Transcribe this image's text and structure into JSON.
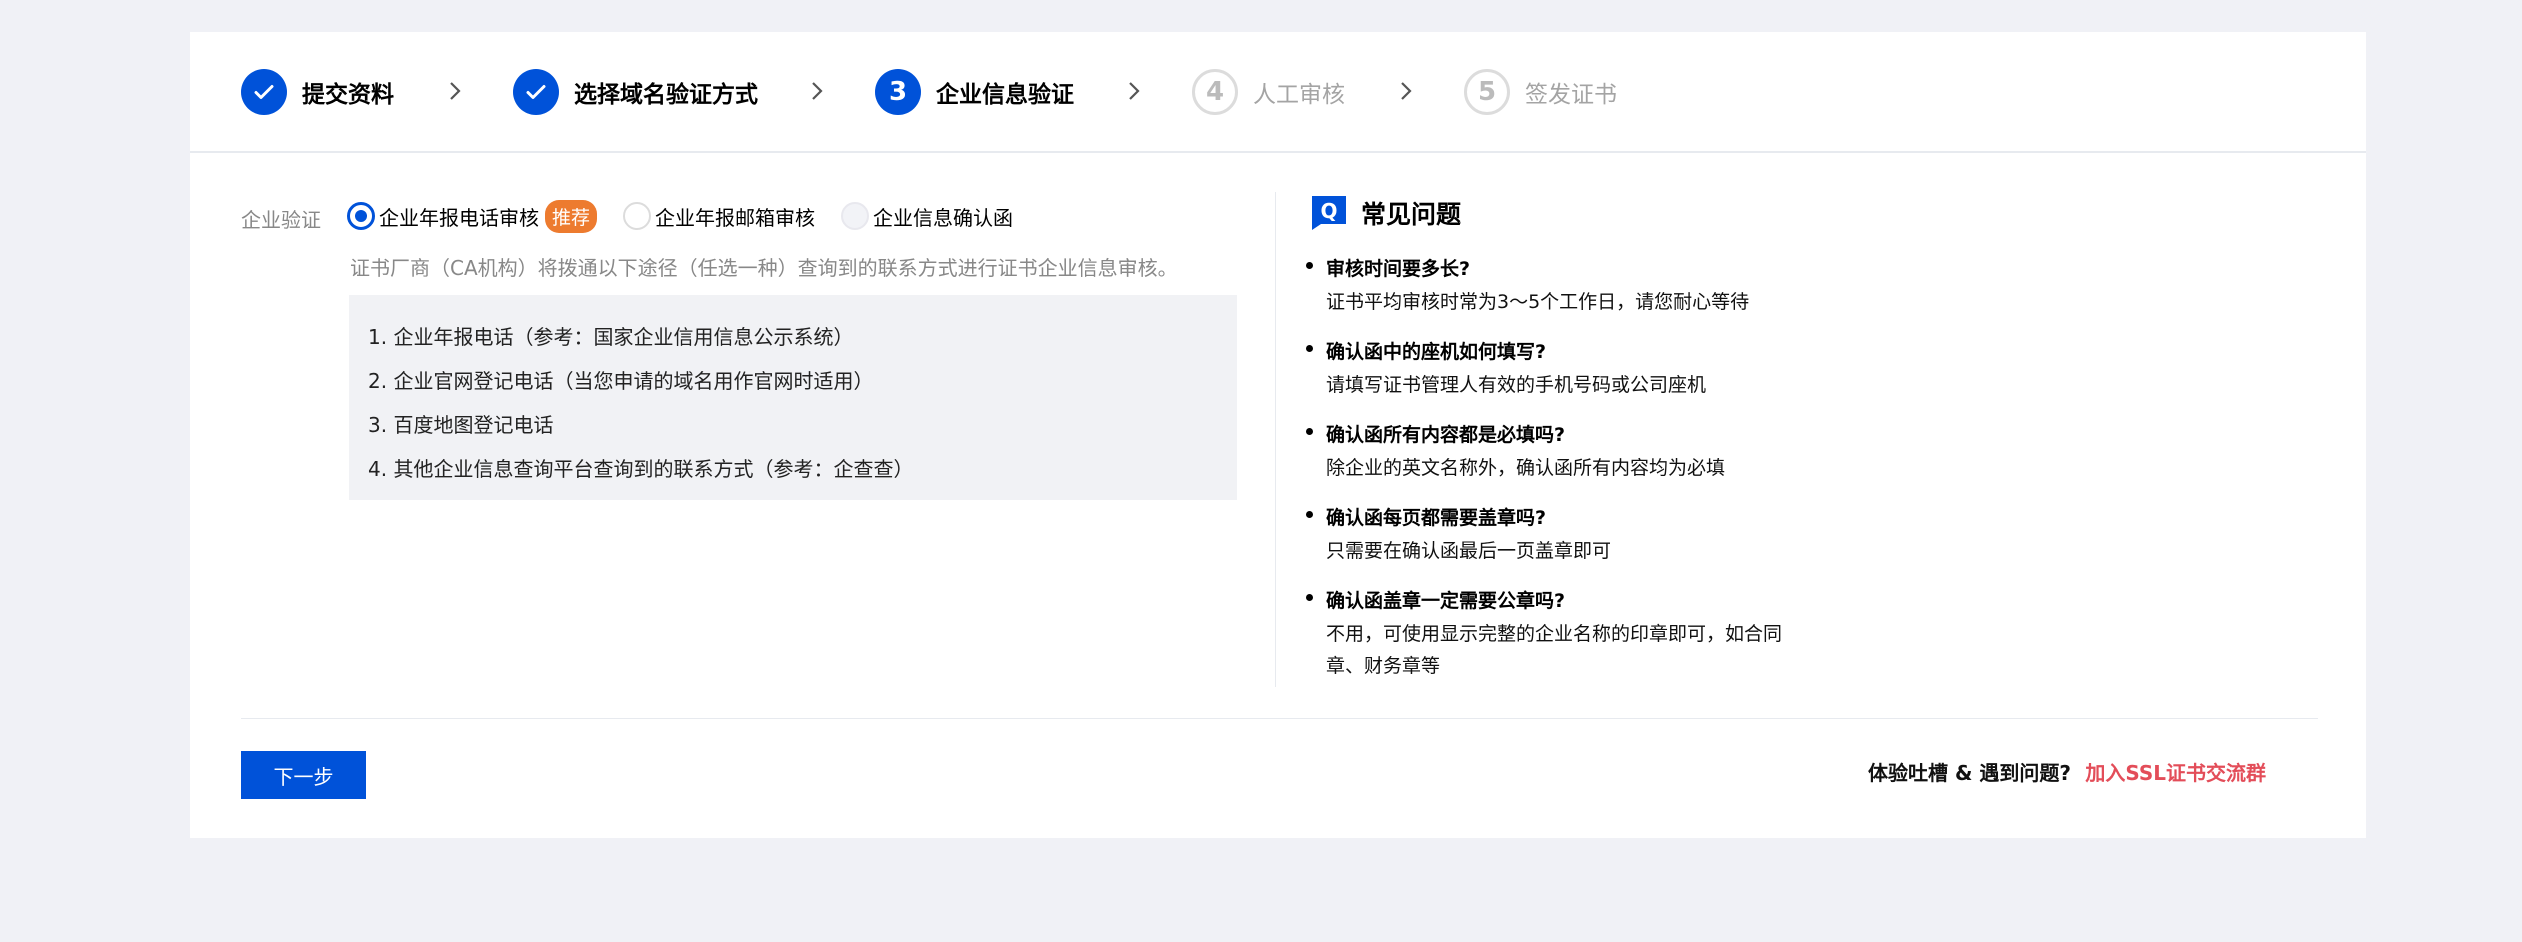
{
  "steps": [
    {
      "number": "✓",
      "label": "提交资料",
      "state": "done"
    },
    {
      "number": "✓",
      "label": "选择域名验证方式",
      "state": "done"
    },
    {
      "number": "3",
      "label": "企业信息验证",
      "state": "active"
    },
    {
      "number": "4",
      "label": "人工审核",
      "state": "todo"
    },
    {
      "number": "5",
      "label": "签发证书",
      "state": "todo"
    }
  ],
  "form": {
    "field_label": "企业验证",
    "options": [
      {
        "label": "企业年报电话审核",
        "badge": "推荐",
        "selected": true
      },
      {
        "label": "企业年报邮箱审核",
        "selected": false
      },
      {
        "label": "企业信息确认函",
        "selected": false
      }
    ],
    "description": "证书厂商（CA机构）将拨通以下途径（任选一种）查询到的联系方式进行证书企业信息审核。",
    "info_lines": [
      "1. 企业年报电话（参考：国家企业信用信息公示系统）",
      "2. 企业官网登记电话（当您申请的域名用作官网时适用）",
      "3. 百度地图登记电话",
      "4. 其他企业信息查询平台查询到的联系方式（参考：企查查）"
    ]
  },
  "faq": {
    "icon_letter": "Q",
    "title": "常见问题",
    "items": [
      {
        "q": "审核时间要多长?",
        "a": "证书平均审核时常为3～5个工作日，请您耐心等待"
      },
      {
        "q": "确认函中的座机如何填写?",
        "a": "请填写证书管理人有效的手机号码或公司座机"
      },
      {
        "q": "确认函所有内容都是必填吗?",
        "a": "除企业的英文名称外，确认函所有内容均为必填"
      },
      {
        "q": "确认函每页都需要盖章吗?",
        "a": "只需要在确认函最后一页盖章即可"
      },
      {
        "q": "确认函盖章一定需要公章吗?",
        "a": "不用，可使用显示完整的企业名称的印章即可，如合同章、财务章等"
      }
    ]
  },
  "footer": {
    "next_label": "下一步",
    "feedback_text": "体验吐槽 & 遇到问题?",
    "feedback_link": "加入SSL证书交流群"
  },
  "colors": {
    "primary": "#0052d9",
    "badge": "#ed7b2f",
    "link": "#e34d59"
  }
}
